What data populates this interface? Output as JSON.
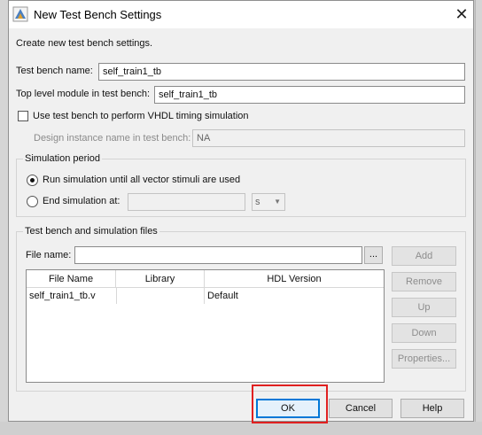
{
  "dialog": {
    "title": "New Test Bench Settings",
    "intro": "Create new test bench settings.",
    "test_bench_name_label": "Test bench name:",
    "test_bench_name_value": "self_train1_tb",
    "top_level_label": "Top level module in test bench:",
    "top_level_value": "self_train1_tb",
    "vhdl_timing_label": "Use test bench to perform VHDL timing simulation",
    "vhdl_timing_checked": false,
    "design_instance_label": "Design instance name in test bench:",
    "design_instance_value": "NA"
  },
  "simulation_period": {
    "title": "Simulation period",
    "option_run_label": "Run simulation until all vector stimuli are used",
    "option_end_label": "End simulation at:",
    "selected": "run",
    "end_value": "",
    "unit_value": "s"
  },
  "files": {
    "title": "Test bench and simulation files",
    "file_name_label": "File name:",
    "file_name_value": "",
    "browse_label": "...",
    "columns": [
      "File Name",
      "Library",
      "HDL Version"
    ],
    "rows": [
      {
        "file": "self_train1_tb.v",
        "library": "",
        "hdl": "Default"
      }
    ],
    "buttons": {
      "add": "Add",
      "remove": "Remove",
      "up": "Up",
      "down": "Down",
      "properties": "Properties..."
    }
  },
  "footer": {
    "ok": "OK",
    "cancel": "Cancel",
    "help": "Help"
  },
  "colors": {
    "highlight": "#e02020",
    "default_button_border": "#0078d7"
  }
}
